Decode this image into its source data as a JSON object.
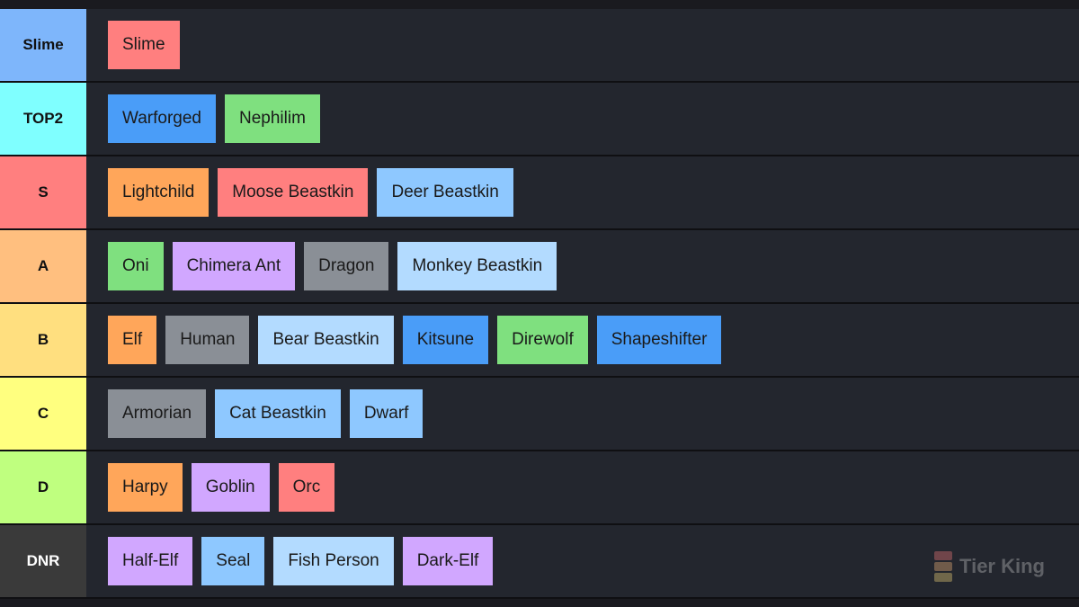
{
  "colors": {
    "background": "#23262e",
    "item_red": "#ff7f7f",
    "item_blue": "#4a9df8",
    "item_green": "#7fe07f",
    "item_orange": "#ffa65a",
    "item_lightblue": "#8ec8ff",
    "item_paleblue": "#b3dbff",
    "item_purple": "#d1a7ff",
    "item_gray": "#8a8f96"
  },
  "tiers": [
    {
      "label": "Slime",
      "color": "#7eb6fb",
      "text_color": "#111111",
      "items": [
        {
          "name": "Slime",
          "color": "#ff7f7f"
        }
      ]
    },
    {
      "label": "TOP2",
      "color": "#7fffff",
      "text_color": "#111111",
      "items": [
        {
          "name": "Warforged",
          "color": "#4a9df8"
        },
        {
          "name": "Nephilim",
          "color": "#7fe07f"
        }
      ]
    },
    {
      "label": "S",
      "color": "#ff7f7f",
      "text_color": "#111111",
      "items": [
        {
          "name": "Lightchild",
          "color": "#ffa65a"
        },
        {
          "name": "Moose Beastkin",
          "color": "#ff7f7f"
        },
        {
          "name": "Deer Beastkin",
          "color": "#8ec8ff"
        }
      ]
    },
    {
      "label": "A",
      "color": "#ffbf7f",
      "text_color": "#111111",
      "items": [
        {
          "name": "Oni",
          "color": "#7fe07f"
        },
        {
          "name": "Chimera Ant",
          "color": "#d1a7ff"
        },
        {
          "name": "Dragon",
          "color": "#8a8f96"
        },
        {
          "name": "Monkey Beastkin",
          "color": "#b3dbff"
        }
      ]
    },
    {
      "label": "B",
      "color": "#ffdf7f",
      "text_color": "#111111",
      "items": [
        {
          "name": "Elf",
          "color": "#ffa65a"
        },
        {
          "name": "Human",
          "color": "#8a8f96"
        },
        {
          "name": "Bear Beastkin",
          "color": "#b3dbff"
        },
        {
          "name": "Kitsune",
          "color": "#4a9df8"
        },
        {
          "name": "Direwolf",
          "color": "#7fe07f"
        },
        {
          "name": "Shapeshifter",
          "color": "#4a9df8"
        }
      ]
    },
    {
      "label": "C",
      "color": "#ffff7f",
      "text_color": "#111111",
      "items": [
        {
          "name": "Armorian",
          "color": "#8a8f96"
        },
        {
          "name": "Cat Beastkin",
          "color": "#8ec8ff"
        },
        {
          "name": "Dwarf",
          "color": "#8ec8ff"
        }
      ]
    },
    {
      "label": "D",
      "color": "#bfff7f",
      "text_color": "#111111",
      "items": [
        {
          "name": "Harpy",
          "color": "#ffa65a"
        },
        {
          "name": "Goblin",
          "color": "#d1a7ff"
        },
        {
          "name": "Orc",
          "color": "#ff7f7f"
        }
      ]
    },
    {
      "label": "DNR",
      "color": "#3a3a3a",
      "text_color": "#ffffff",
      "items": [
        {
          "name": "Half-Elf",
          "color": "#d1a7ff"
        },
        {
          "name": "Seal",
          "color": "#8ec8ff"
        },
        {
          "name": "Fish Person",
          "color": "#b3dbff"
        },
        {
          "name": "Dark-Elf",
          "color": "#d1a7ff"
        }
      ]
    }
  ],
  "watermark": {
    "text": "Tier King",
    "icon": "tier-king-logo-icon"
  }
}
